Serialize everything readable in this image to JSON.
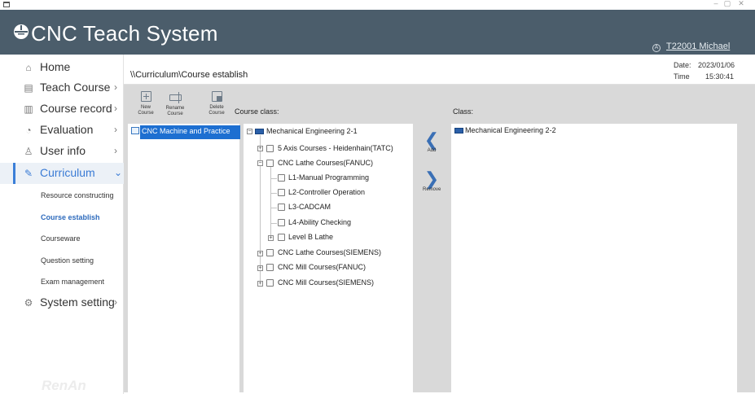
{
  "window": {
    "minimize": "–",
    "maximize": "▢",
    "close": "✕"
  },
  "header": {
    "title": "CNC Teach System",
    "user": "T22001 Michael"
  },
  "sidebar": {
    "items": [
      {
        "label": "Home",
        "icon": "home-icon",
        "glyph": "⌂",
        "chevron": ""
      },
      {
        "label": "Teach Course",
        "icon": "list-icon",
        "glyph": "▤",
        "chevron": "›"
      },
      {
        "label": "Course record",
        "icon": "document-icon",
        "glyph": "▥",
        "chevron": "›"
      },
      {
        "label": "Evaluation",
        "icon": "chart-icon",
        "glyph": "◔",
        "chevron": "›"
      },
      {
        "label": "User info",
        "icon": "user-icon",
        "glyph": "♙",
        "chevron": "›"
      },
      {
        "label": "Curriculum",
        "icon": "pencil-icon",
        "glyph": "✎",
        "chevron": "⌄"
      },
      {
        "label": "System setting",
        "icon": "gear-icon",
        "glyph": "⚙",
        "chevron": "›"
      }
    ],
    "subitems": [
      "Resource constructing",
      "Course establish",
      "Courseware",
      "Question setting",
      "Exam management"
    ],
    "brand": "RenAn"
  },
  "main": {
    "breadcrumb": "\\\\Curriculum\\Course establish",
    "date_label": "Date:",
    "date_value": "2023/01/06",
    "time_label": "Time",
    "time_value": "15:30:41"
  },
  "toolbar": {
    "new_line1": "New",
    "new_line2": "Course",
    "rename_line1": "Rename",
    "rename_line2": "Course",
    "delete_line1": "Delete",
    "delete_line2": "Course"
  },
  "columns": {
    "course_class": "Course class:",
    "class": "Class:"
  },
  "courses": {
    "selected": "CNC Machine and Practice"
  },
  "tree": {
    "root": "Mechanical Engineering 2-1",
    "n1": "5 Axis Courses - Heidenhain(TATC)",
    "n2": "CNC Lathe Courses(FANUC)",
    "n2a": "L1-Manual Programming",
    "n2b": "L2-Controller Operation",
    "n2c": "L3-CADCAM",
    "n2d": "L4-Ability Checking",
    "n2e": "Level B Lathe",
    "n3": "CNC Lathe Courses(SIEMENS)",
    "n4": "CNC Mill Courses(FANUC)",
    "n5": "CNC Mill Courses(SIEMENS)"
  },
  "actions": {
    "add_glyph": "❮",
    "add": "Add",
    "remove_glyph": "❯",
    "remove": "Remove"
  },
  "classes": {
    "item": "Mechanical Engineering 2-2"
  },
  "colors": {
    "header_bg": "#4b5d6b",
    "accent": "#3a7bd5",
    "selection": "#1d6fd1",
    "toolbar_bg": "#d9d9d9"
  }
}
